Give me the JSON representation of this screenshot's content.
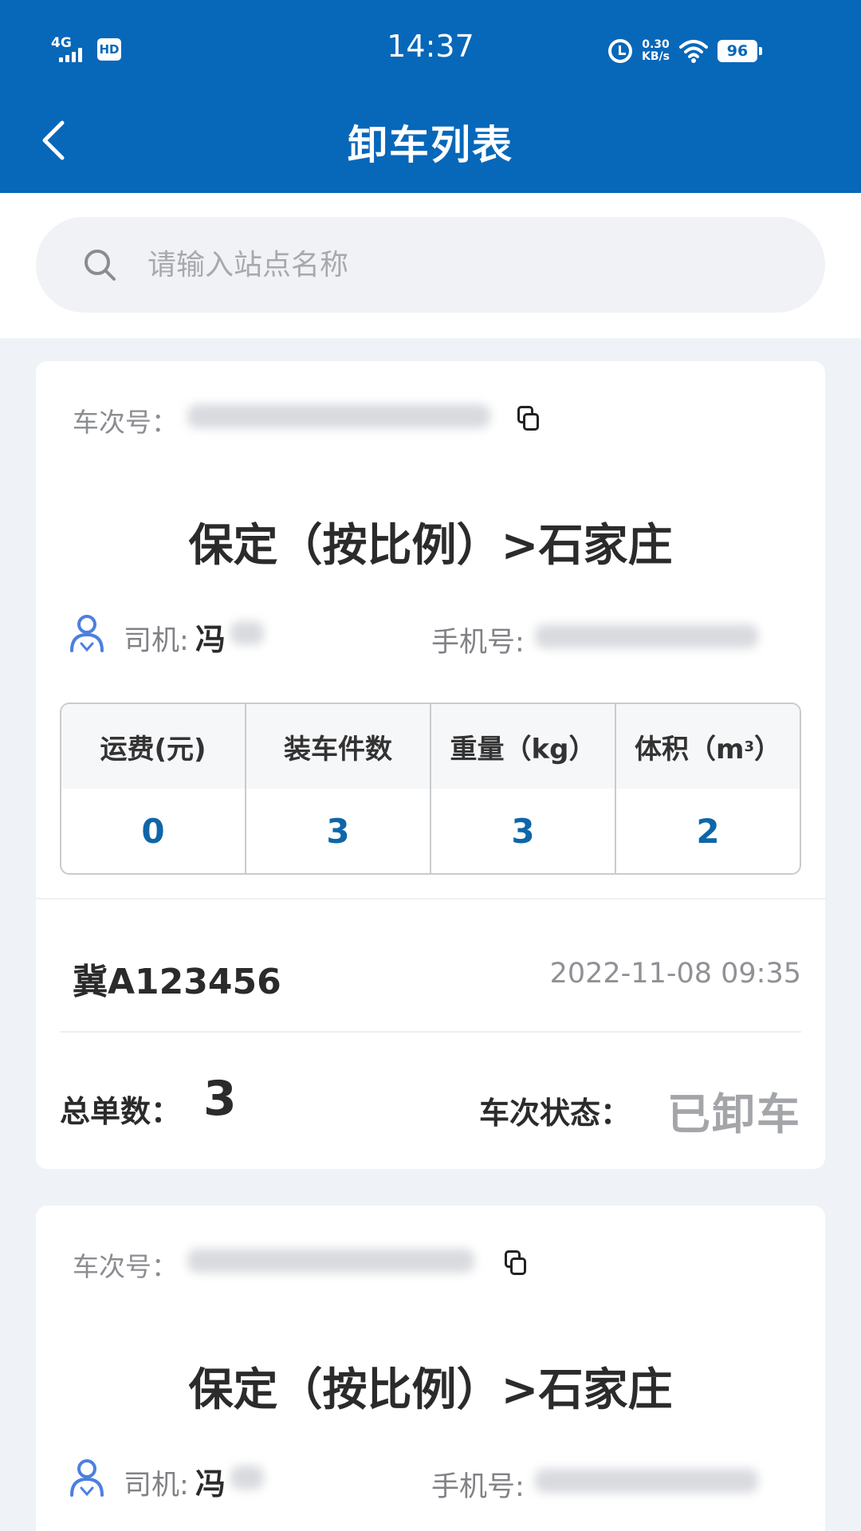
{
  "status_bar": {
    "network": "4G",
    "hd": "HD",
    "time": "14:37",
    "speed_value": "0.30",
    "speed_unit": "KB/s",
    "battery": "96"
  },
  "header": {
    "title": "卸车列表",
    "back_icon": "chevron-left-icon"
  },
  "search": {
    "placeholder": "请输入站点名称",
    "value": "",
    "icon": "search-icon"
  },
  "colors": {
    "brand": "#0767b9",
    "stat_value": "#0e66a8",
    "status_unloaded": "#a3a5a9"
  },
  "trips": [
    {
      "trip_label": "车次号：",
      "route": "保定（按比例）>石家庄",
      "driver_label": "司机:",
      "driver_name": "冯",
      "phone_label": "手机号:",
      "stats": [
        {
          "label": "运费(元)",
          "value": "0"
        },
        {
          "label": "装车件数",
          "value": "3"
        },
        {
          "label": "重量（kg）",
          "value": "3"
        },
        {
          "label": "体积（m",
          "sup": "3",
          "label_suffix": "）",
          "value": "2"
        }
      ],
      "plate": "冀A123456",
      "datetime": "2022-11-08 09:35",
      "total_label": "总单数：",
      "total_value": "3",
      "status_label": "车次状态：",
      "status_value": "已卸车"
    },
    {
      "trip_label": "车次号：",
      "route": "保定（按比例）>石家庄",
      "driver_label": "司机:",
      "driver_name": "冯",
      "phone_label": "手机号:"
    }
  ]
}
